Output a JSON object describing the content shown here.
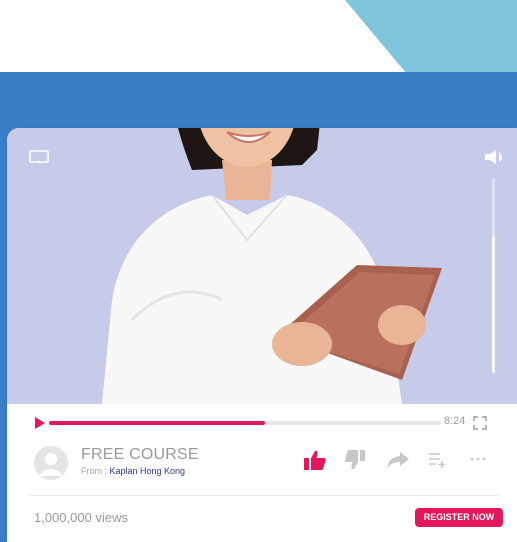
{
  "player": {
    "time": "8:24",
    "progress": 0.55,
    "volume": 0.7
  },
  "course": {
    "title": "FREE COURSE",
    "from_prefix": "From : ",
    "channel": "Kaplan Hong Kong"
  },
  "stats": {
    "views": "1,000,000 views"
  },
  "cta": {
    "register_label": "REGISTER NOW"
  },
  "colors": {
    "accent": "#e3175a",
    "band_blue": "#3b7ec8",
    "teal": "#7fc6dc",
    "video_bg": "#c5cbe9",
    "channel_link": "#2a3b8f"
  },
  "icons": {
    "cast": "cast-icon",
    "volume": "volume-icon",
    "play": "play-icon",
    "fullscreen": "fullscreen-icon",
    "like": "thumbs-up-icon",
    "dislike": "thumbs-down-icon",
    "share": "share-arrow-icon",
    "playlist": "add-to-playlist-icon",
    "more": "more-dots-icon"
  }
}
